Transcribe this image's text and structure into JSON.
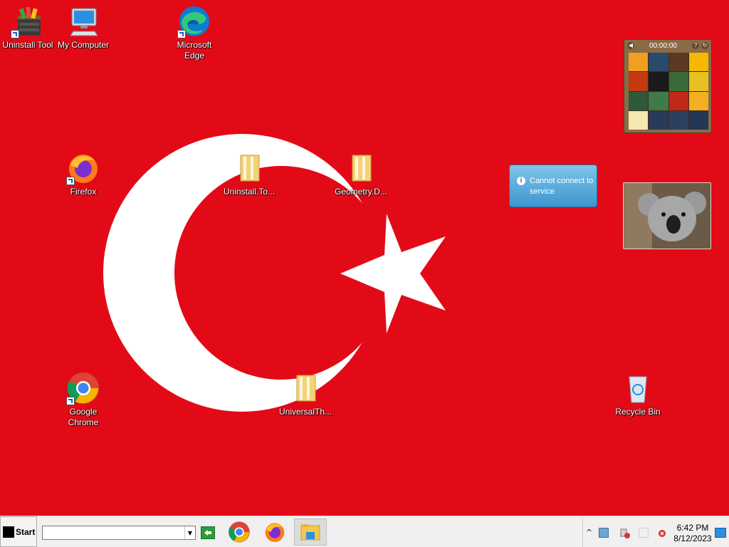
{
  "desktop": {
    "icons": [
      {
        "label": "Uninstall Tool"
      },
      {
        "label": "My Computer"
      },
      {
        "label": "Microsoft Edge"
      },
      {
        "label": "Firefox"
      },
      {
        "label": "Uninstall.To..."
      },
      {
        "label": "Geometry.D..."
      },
      {
        "label": "Google Chrome"
      },
      {
        "label": "UniversalTh..."
      },
      {
        "label": "Recycle Bin"
      }
    ]
  },
  "gadgets": {
    "puzzle": {
      "timer": "00:00:00",
      "help": "?"
    },
    "weather": {
      "message": "Cannot connect to service"
    },
    "photo": {
      "subject_icon": "koala-photo"
    }
  },
  "taskbar": {
    "start_label": "Start",
    "address_value": "",
    "clock_time": "6:42 PM",
    "clock_date": "8/12/2023",
    "pinned": [
      "chrome-icon",
      "firefox-icon",
      "file-explorer-icon"
    ]
  },
  "colors": {
    "wallpaper": "#e30a17",
    "taskbar": "#f0f0f0"
  }
}
